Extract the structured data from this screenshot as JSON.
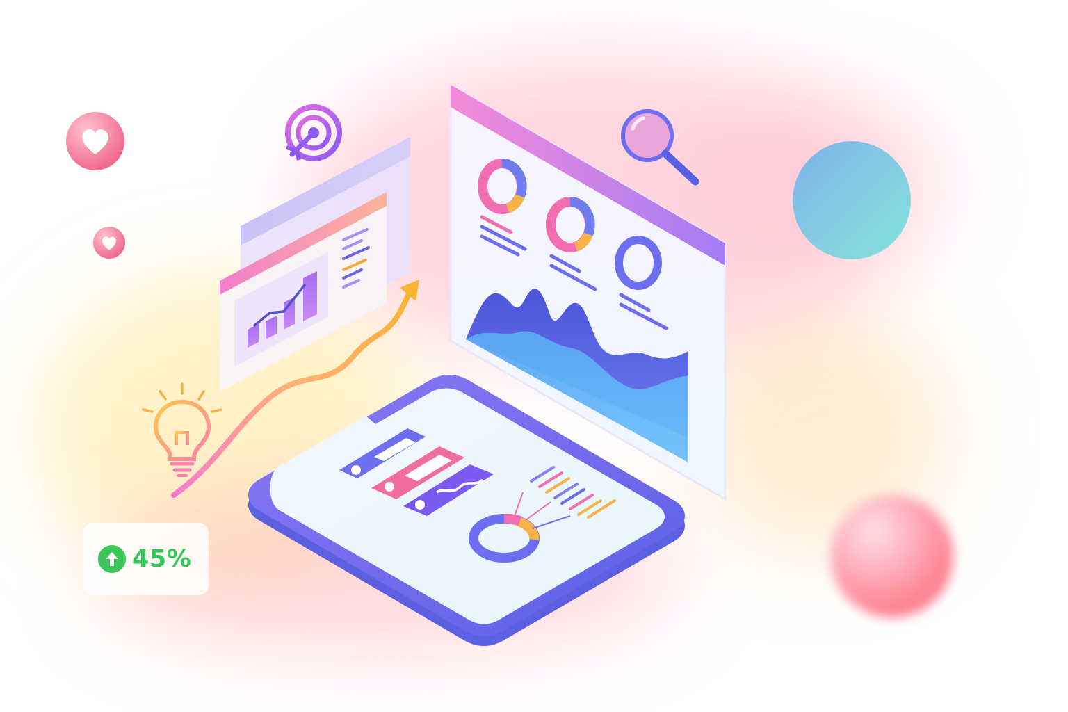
{
  "stat_badge": {
    "value": "45%",
    "icon": "arrow-up-circle-icon",
    "color": "#34c759"
  },
  "floating_icons": [
    "heart-icon",
    "heart-icon",
    "target-icon",
    "magnifier-icon",
    "lightbulb-icon"
  ],
  "palette": {
    "purple": "#6e63e8",
    "pink": "#f27fb7",
    "orange": "#f6a93b",
    "blue": "#64b5f6",
    "teal": "#7fdcd8"
  }
}
